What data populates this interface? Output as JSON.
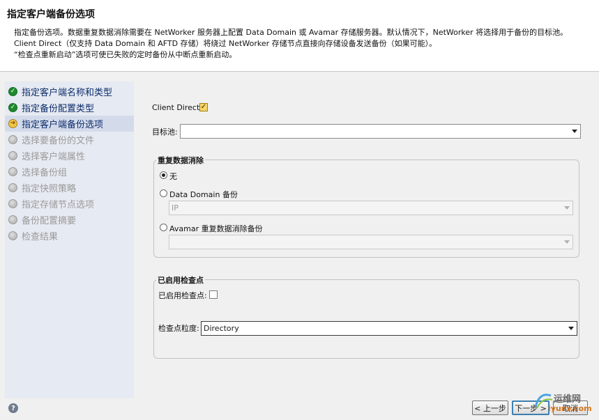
{
  "header": {
    "title": "指定客户端备份选项",
    "description_lines": [
      "指定备份选项。数据重复数据消除需要在 NetWorker 服务器上配置 Data Domain 或 Avamar 存储服务器。默认情况下，NetWorker 将选择用于备份的目标池。",
      "Client Direct（仅支持 Data Domain 和 AFTD 存储）将绕过 NetWorker 存储节点直接向存储设备发送备份（如果可能）。",
      "“检查点重新启动”选项可使已失败的定时备份从中断点重新启动。"
    ]
  },
  "wizard_steps": [
    {
      "label": "指定客户端名称和类型",
      "status": "done"
    },
    {
      "label": "指定备份配置类型",
      "status": "done"
    },
    {
      "label": "指定客户端备份选项",
      "status": "current"
    },
    {
      "label": "选择要备份的文件",
      "status": "pending"
    },
    {
      "label": "选择客户端属性",
      "status": "pending"
    },
    {
      "label": "选择备份组",
      "status": "pending"
    },
    {
      "label": "指定快照策略",
      "status": "pending"
    },
    {
      "label": "指定存储节点选项",
      "status": "pending"
    },
    {
      "label": "备份配置摘要",
      "status": "pending"
    },
    {
      "label": "检查结果",
      "status": "pending"
    }
  ],
  "form": {
    "client_direct_label": "Client Direct:",
    "client_direct_checked": true,
    "target_pool_label": "目标池:",
    "target_pool_value": "",
    "dedup": {
      "title": "重复数据消除",
      "option_none": "无",
      "option_data_domain": "Data Domain 备份",
      "data_domain_value": "IP",
      "option_avamar": "Avamar 重复数据消除备份",
      "avamar_value": "",
      "selected": "none"
    },
    "checkpoint": {
      "title": "已启用检查点",
      "enabled_label": "已启用检查点:",
      "enabled_checked": false,
      "granularity_label": "检查点粒度:",
      "granularity_value": "Directory"
    }
  },
  "footer": {
    "help_symbol": "?",
    "back_label": "< 上一步",
    "next_label": "下一步 >",
    "cancel_label": "取消"
  },
  "watermark": {
    "text": "运维网",
    "sub": "iyunv.com"
  }
}
